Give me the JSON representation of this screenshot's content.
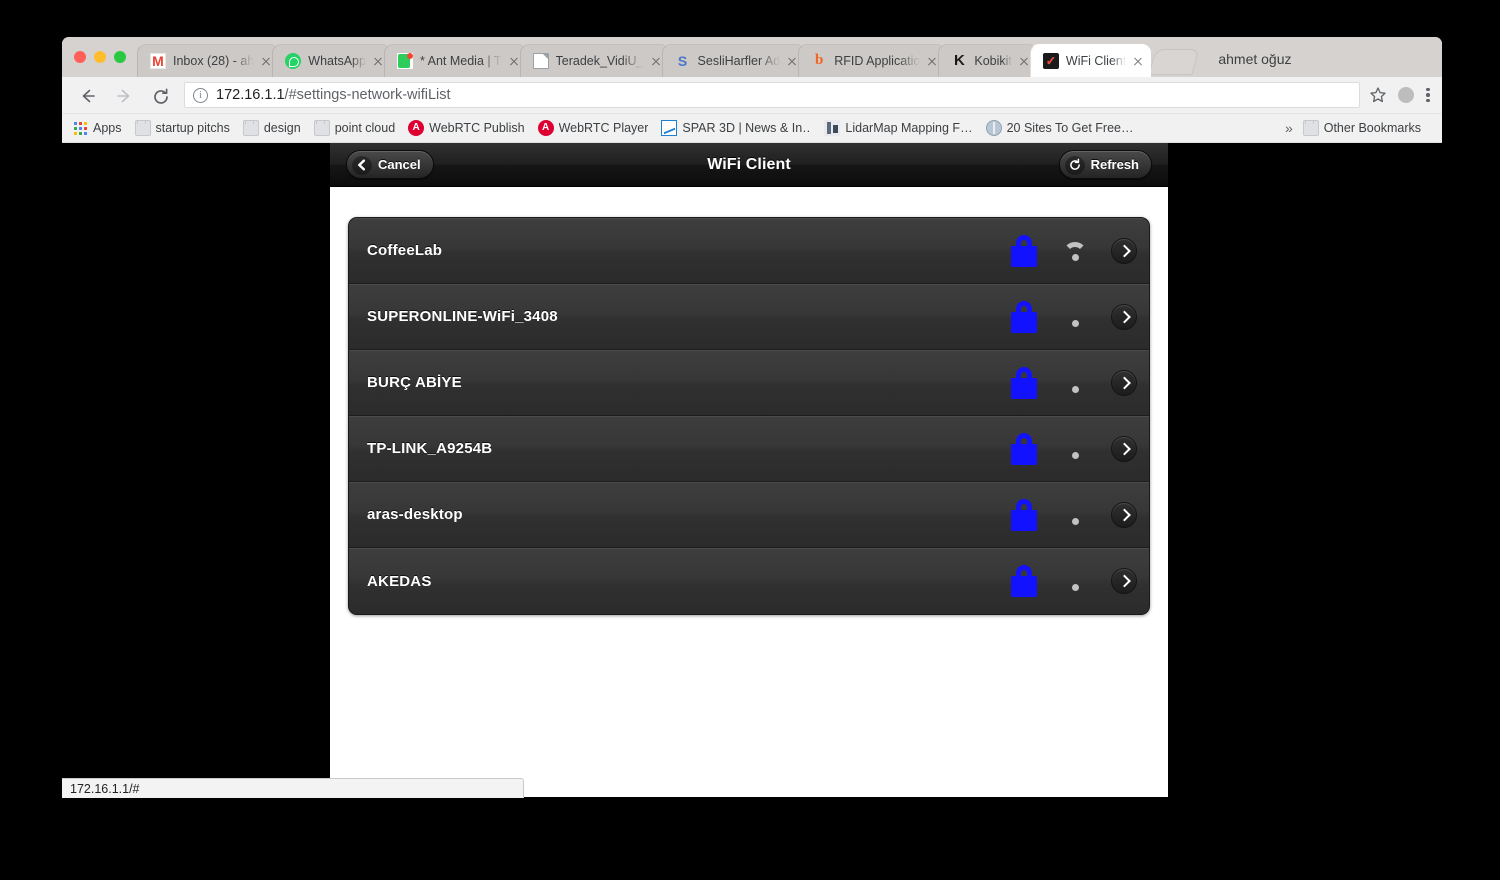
{
  "window": {
    "user_name": "ahmet oğuz",
    "traffic_lights": [
      "close",
      "minimize",
      "maximize"
    ]
  },
  "tabs": [
    {
      "title": "Inbox (28) - ah",
      "favicon": "gmail-icon",
      "active": false
    },
    {
      "title": "WhatsApp",
      "favicon": "whatsapp-icon",
      "active": false
    },
    {
      "title": "* Ant Media | T",
      "favicon": "ant-media-icon",
      "active": false
    },
    {
      "title": "Teradek_VidiU_",
      "favicon": "document-icon",
      "active": false
    },
    {
      "title": "SesliHarfler Ad",
      "favicon": "sesliharfler-icon",
      "active": false
    },
    {
      "title": "RFID Applicatio",
      "favicon": "rfid-icon",
      "active": false
    },
    {
      "title": "Kobikit",
      "favicon": "kobikit-icon",
      "active": false
    },
    {
      "title": "WiFi Client",
      "favicon": "wifi-client-icon",
      "active": true
    }
  ],
  "toolbar": {
    "back_label": "Back",
    "forward_label": "Forward",
    "reload_label": "Reload",
    "url_host": "172.16.1.1",
    "url_path": "/#settings-network-wifiList",
    "url_full": "172.16.1.1/#settings-network-wifiList",
    "bookmark_label": "Bookmark this page",
    "menu_label": "Customize and control Google Chrome"
  },
  "bookmarks": {
    "apps_label": "Apps",
    "items": [
      {
        "label": "startup pitchs",
        "icon": "folder-icon"
      },
      {
        "label": "design",
        "icon": "folder-icon"
      },
      {
        "label": "point cloud",
        "icon": "folder-icon"
      },
      {
        "label": "WebRTC Publish",
        "icon": "angular-icon"
      },
      {
        "label": "WebRTC Player",
        "icon": "angular-icon"
      },
      {
        "label": "SPAR 3D | News & In…",
        "icon": "spar-icon"
      },
      {
        "label": "LidarMap Mapping F…",
        "icon": "lidar-icon"
      },
      {
        "label": "20 Sites To Get Free…",
        "icon": "globe-icon"
      }
    ],
    "overflow_label": "»",
    "other_bookmarks_label": "Other Bookmarks"
  },
  "app": {
    "title": "WiFi Client",
    "cancel_label": "Cancel",
    "refresh_label": "Refresh",
    "networks": [
      {
        "ssid": "CoffeeLab",
        "secured": true,
        "signal": "medium"
      },
      {
        "ssid": "SUPERONLINE-WiFi_3408",
        "secured": true,
        "signal": "weak"
      },
      {
        "ssid": "BURÇ ABİYE",
        "secured": true,
        "signal": "weak"
      },
      {
        "ssid": "TP-LINK_A9254B",
        "secured": true,
        "signal": "weak"
      },
      {
        "ssid": "aras-desktop",
        "secured": true,
        "signal": "weak"
      },
      {
        "ssid": "AKEDAS",
        "secured": true,
        "signal": "weak"
      }
    ]
  },
  "status_bar": {
    "text": "172.16.1.1/#"
  },
  "colors": {
    "lock_blue": "#1212ff",
    "tab_active_bg": "#ffffff",
    "tab_strip_bg": "#d6d2cf",
    "app_header_dark": "#1f1f1f",
    "row_bg": "#373737"
  }
}
